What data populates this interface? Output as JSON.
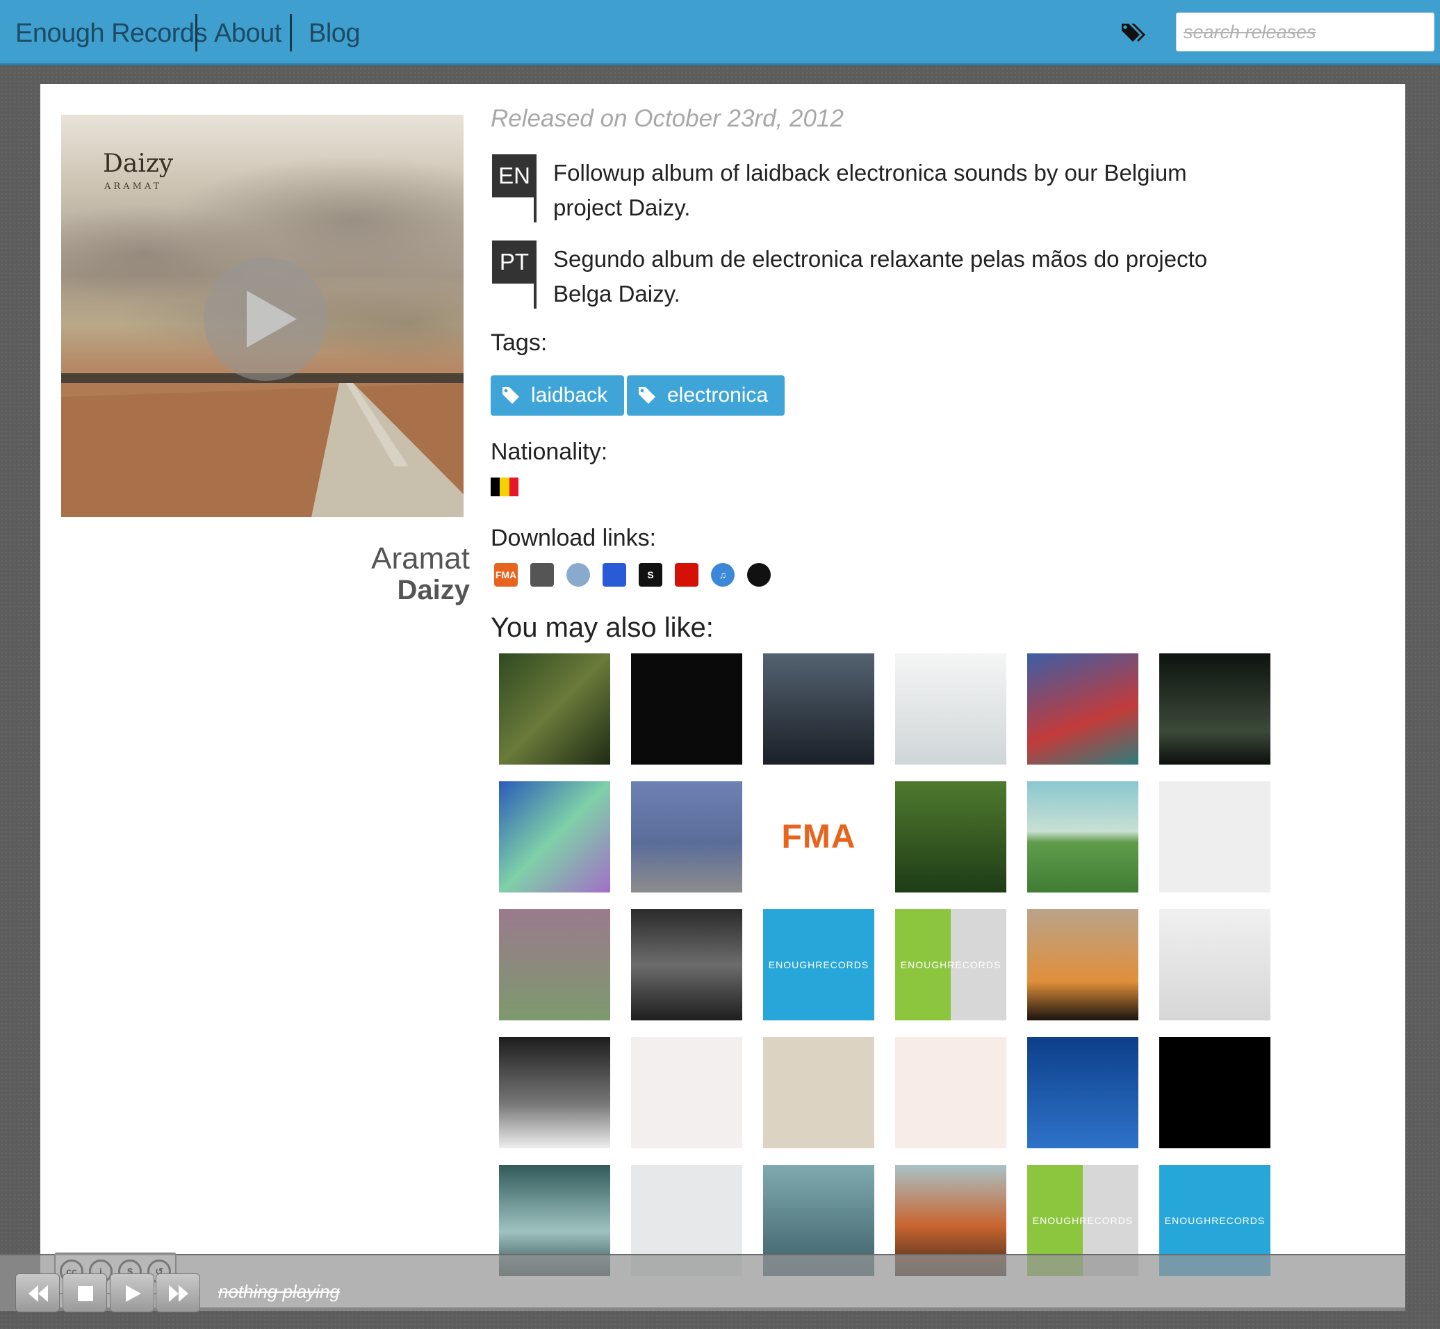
{
  "nav": {
    "brand": "Enough Records",
    "items": [
      "About",
      "Blog"
    ],
    "tags_icon": "tags-icon",
    "search_placeholder": "search releases"
  },
  "release": {
    "cover_title": "Daizy",
    "cover_subtitle": "ARAMAT",
    "title": "Aramat",
    "artist": "Daizy",
    "released": "Released on October 23rd, 2012",
    "descriptions": [
      {
        "lang": "EN",
        "text": "Followup album of laidback electronica sounds by our Belgium project Daizy."
      },
      {
        "lang": "PT",
        "text": "Segundo album de electronica relaxante pelas mãos do projecto Belga Daizy."
      }
    ],
    "tags_label": "Tags:",
    "tags": [
      "laidback",
      "electronica"
    ],
    "nationality_label": "Nationality:",
    "nationality_flag": "belgium-flag",
    "flag_colors": [
      "#000000",
      "#f4d200",
      "#e6172d"
    ],
    "download_label": "Download links:",
    "downloads": [
      {
        "name": "fma-icon",
        "color": "#e8641e",
        "label": "FMA"
      },
      {
        "name": "internet-archive-icon",
        "color": "#555555",
        "label": ""
      },
      {
        "name": "sonicsquirrel-icon",
        "color": "#88aacc",
        "label": ""
      },
      {
        "name": "jamendo-icon",
        "color": "#2a5bd7",
        "label": ""
      },
      {
        "name": "scene-org-icon",
        "color": "#111111",
        "label": "S"
      },
      {
        "name": "lastfm-icon",
        "color": "#d51007",
        "label": ""
      },
      {
        "name": "itunes-icon",
        "color": "#3b87d8",
        "label": "♫"
      },
      {
        "name": "discogs-icon",
        "color": "#111111",
        "label": ""
      }
    ]
  },
  "also_like": {
    "label": "You may also like:",
    "thumbnails": [
      {
        "name": "album-thumb-the-end",
        "bg": "linear-gradient(135deg,#2f4a21,#6a7a3a 50%,#1e2b14)",
        "label": ""
      },
      {
        "name": "album-thumb-ignis",
        "bg": "#0a0a0a",
        "label": ""
      },
      {
        "name": "album-thumb-dark-structure",
        "bg": "linear-gradient(180deg,#536270,#1b2028)",
        "label": ""
      },
      {
        "name": "album-thumb-inom",
        "bg": "linear-gradient(180deg,#f5f5f5,#cfd6d8)",
        "label": ""
      },
      {
        "name": "album-thumb-woman-red",
        "bg": "linear-gradient(160deg,#3c5ea6,#c33b3b 60%,#2d7d7a)",
        "label": ""
      },
      {
        "name": "album-thumb-inner-peace",
        "bg": "linear-gradient(180deg,#0e1410,#3b4a38 70%,#0d100d)",
        "label": ""
      },
      {
        "name": "album-thumb-microcosmos",
        "bg": "linear-gradient(135deg,#2b5cb8,#7fd0a8 50%,#a26fc7)",
        "label": ""
      },
      {
        "name": "album-thumb-amitron",
        "bg": "linear-gradient(180deg,#6d82b4,#5a6d9a 55%,#8c8c8c)",
        "label": ""
      },
      {
        "name": "album-thumb-fma",
        "bg": "#ffffff",
        "label": "FMA",
        "fg": "#e8641e"
      },
      {
        "name": "album-thumb-anime",
        "bg": "linear-gradient(180deg,#4f7a2f,#1e3d16)",
        "label": ""
      },
      {
        "name": "album-thumb-daizy",
        "bg": "linear-gradient(180deg,#89c7cf,#c9e0d4 45%,#5f9c4a 55%,#3f7d34)",
        "label": ""
      },
      {
        "name": "album-thumb-hourglass",
        "bg": "#eeeeee",
        "label": ""
      },
      {
        "name": "album-thumb-gradient-circle",
        "bg": "linear-gradient(180deg,#9a7a8d,#7d9a6d)",
        "label": ""
      },
      {
        "name": "album-thumb-shotmix",
        "bg": "linear-gradient(180deg,#2b2b2b,#6c6c6c 50%,#1e1e1e)",
        "label": ""
      },
      {
        "name": "album-thumb-enough-blue",
        "bg": "#27a7d9",
        "label": "ENOUGHRECORDS"
      },
      {
        "name": "album-thumb-enough-green",
        "bg": "linear-gradient(90deg,#8cc63f 50%,#d7d7d7 50%)",
        "label": "ENOUGHRECORDS"
      },
      {
        "name": "album-thumb-wabi-sabi",
        "bg": "linear-gradient(180deg,#b9a38a,#e08f3a 65%,#1a140f)",
        "label": ""
      },
      {
        "name": "album-thumb-fog",
        "bg": "linear-gradient(180deg,#f0f0f0,#d6d6d6)",
        "label": ""
      },
      {
        "name": "album-thumb-window",
        "bg": "linear-gradient(180deg,#1d1d1d,#777 60%,#eee)",
        "label": ""
      },
      {
        "name": "album-thumb-pink-room",
        "bg": "#f3efef",
        "label": ""
      },
      {
        "name": "album-thumb-vinyl",
        "bg": "#ddd3c2",
        "label": ""
      },
      {
        "name": "album-thumb-karma",
        "bg": "#f7ece6",
        "label": ""
      },
      {
        "name": "album-thumb-skydivers",
        "bg": "linear-gradient(180deg,#0d3f8a,#2e73c9)",
        "label": ""
      },
      {
        "name": "album-thumb-red-tree",
        "bg": "#000000",
        "label": ""
      },
      {
        "name": "album-thumb-teddy",
        "bg": "linear-gradient(180deg,#315a5a,#9fc3c1 60%,#2b4848)",
        "label": ""
      },
      {
        "name": "album-thumb-circles",
        "bg": "#e7e8ea",
        "label": ""
      },
      {
        "name": "album-thumb-girl",
        "bg": "linear-gradient(180deg,#7faab0,#3d5e68)",
        "label": ""
      },
      {
        "name": "album-thumb-volcano",
        "bg": "linear-gradient(180deg,#a9c2c6,#c9642f 55%,#3b2a1d)",
        "label": ""
      },
      {
        "name": "album-thumb-enough-green-2",
        "bg": "linear-gradient(90deg,#8cc63f 50%,#d7d7d7 50%)",
        "label": "ENOUGHRECORDS"
      },
      {
        "name": "album-thumb-enough-blue-2",
        "bg": "#27a7d9",
        "label": "ENOUGHRECORDS"
      }
    ]
  },
  "player": {
    "status": "nothing playing",
    "license": "CC BY NC SA",
    "license_badges": [
      "cc",
      "i",
      "$",
      "↺"
    ],
    "license_caption": [
      "BY",
      "NC",
      "SA"
    ]
  }
}
